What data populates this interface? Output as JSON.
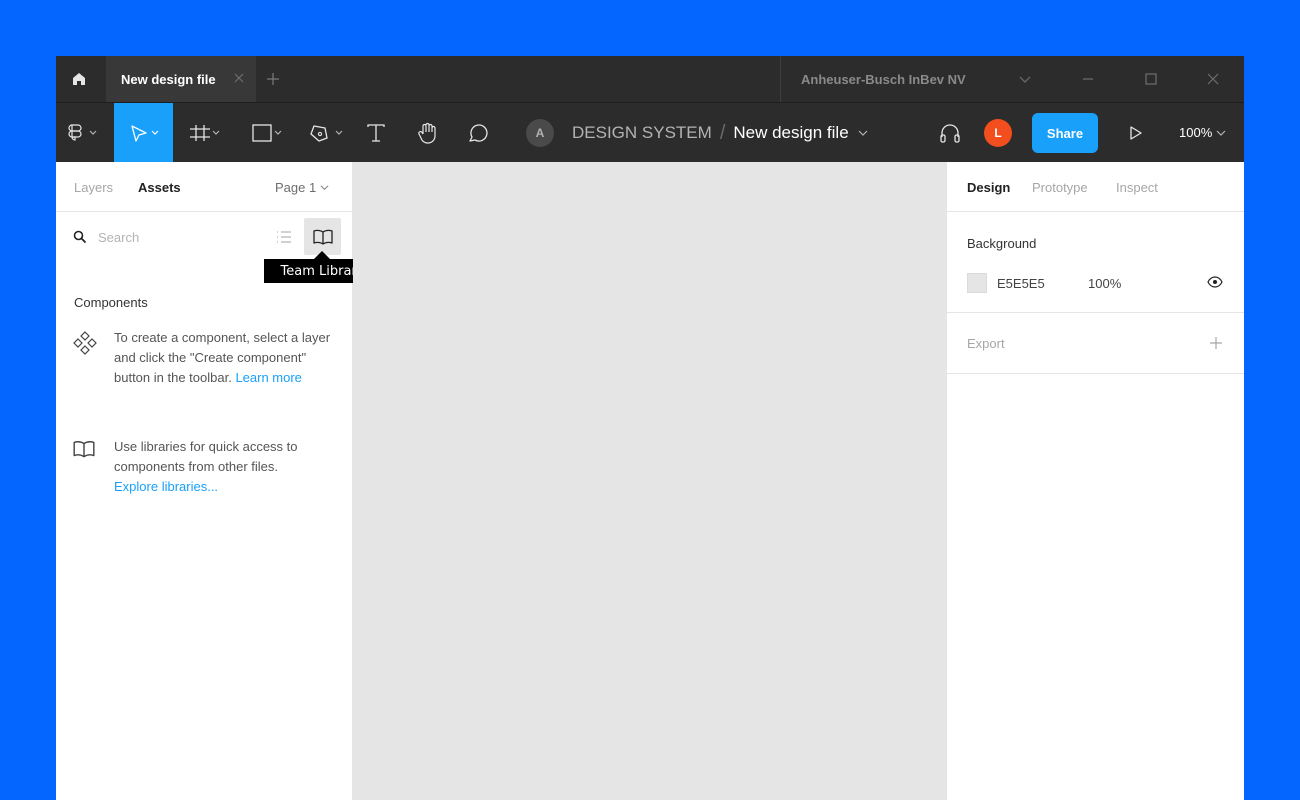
{
  "titlebar": {
    "tab_label": "New design file",
    "org_name": "Anheuser-Busch InBev NV"
  },
  "toolbar": {
    "team_initial": "A",
    "project_name": "DESIGN SYSTEM",
    "separator": "/",
    "file_name": "New design file",
    "user_initial": "L",
    "share_label": "Share",
    "zoom_level": "100%"
  },
  "left_panel": {
    "tabs": [
      {
        "label": "Layers"
      },
      {
        "label": "Assets"
      }
    ],
    "page_label": "Page 1",
    "search_placeholder": "Search",
    "tooltip": "Team Library",
    "components_heading": "Components",
    "create_component_text": "To create a component, select a layer and click the \"Create component\" button in the toolbar.",
    "learn_more": "Learn more",
    "libraries_text": "Use libraries for quick access to components from other files.",
    "explore_libraries": "Explore libraries..."
  },
  "right_panel": {
    "tabs": [
      {
        "label": "Design"
      },
      {
        "label": "Prototype"
      },
      {
        "label": "Inspect"
      }
    ],
    "background_title": "Background",
    "background_hex": "E5E5E5",
    "background_opacity": "100%",
    "export_title": "Export"
  },
  "colors": {
    "page_background": "#0466FF",
    "chrome": "#2C2C2C",
    "accent": "#18A0FB",
    "avatar": "#F24E1E",
    "canvas": "#E5E5E5"
  }
}
